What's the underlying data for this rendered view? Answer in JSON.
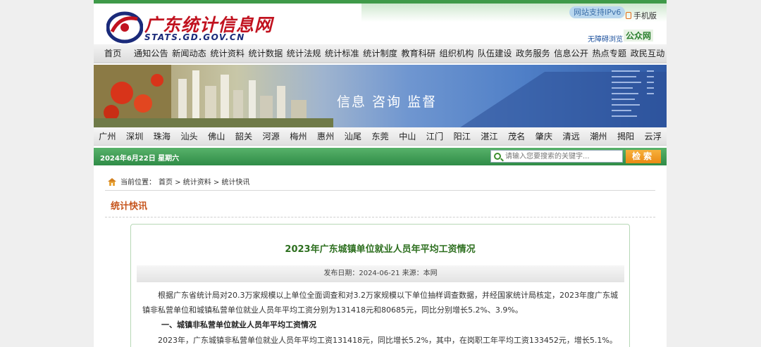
{
  "header": {
    "logo_cn": "广东统计信息网",
    "logo_en": "STATS.GD.GOV.CN",
    "ipv6": "网站支持IPv6",
    "mobile": "手机版",
    "access": "无障碍浏览",
    "gzh": "公众网"
  },
  "nav": [
    "首页",
    "通知公告",
    "新闻动态",
    "统计资料",
    "统计数据",
    "统计法规",
    "统计标准",
    "统计制度",
    "教育科研",
    "组织机构",
    "队伍建设",
    "政务服务",
    "信息公开",
    "热点专题",
    "政民互动"
  ],
  "banner": {
    "slogan": "信息  咨询  监督"
  },
  "cities": [
    "广州",
    "深圳",
    "珠海",
    "汕头",
    "佛山",
    "韶关",
    "河源",
    "梅州",
    "惠州",
    "汕尾",
    "东莞",
    "中山",
    "江门",
    "阳江",
    "湛江",
    "茂名",
    "肇庆",
    "清远",
    "潮州",
    "揭阳",
    "云浮"
  ],
  "toolbar": {
    "date": "2024年6月22日  星期六",
    "search_placeholder": "请输入您要搜索的关键字...",
    "search_button": "检索"
  },
  "breadcrumb": {
    "label": "当前位置：",
    "path": "首页 > 统计资料 > 统计快讯"
  },
  "section_title": "统计快讯",
  "article": {
    "title": "2023年广东城镇单位就业人员年平均工资情况",
    "meta": "发布日期：2024-06-21     来源：本网",
    "para1": "根据广东省统计局对20.3万家规模以上单位全面调查和对3.2万家规模以下单位抽样调查数据，并经国家统计局核定，2023年度广东城镇非私营单位和城镇私营单位就业人员年平均工资分别为131418元和80685元，同比分别增长5.2%、3.9%。",
    "heading1": "一、城镇非私营单位就业人员年平均工资情况",
    "para2": "2023年，广东城镇非私营单位就业人员年平均工资131418元，同比增长5.2%，其中，在岗职工年平均工资133452元，增长5.1%。"
  },
  "colors": {
    "brand_green": "#3f9a49",
    "title_green": "#2d6f1f",
    "accent_orange": "#c6551d",
    "logo_red": "#c1121f"
  }
}
